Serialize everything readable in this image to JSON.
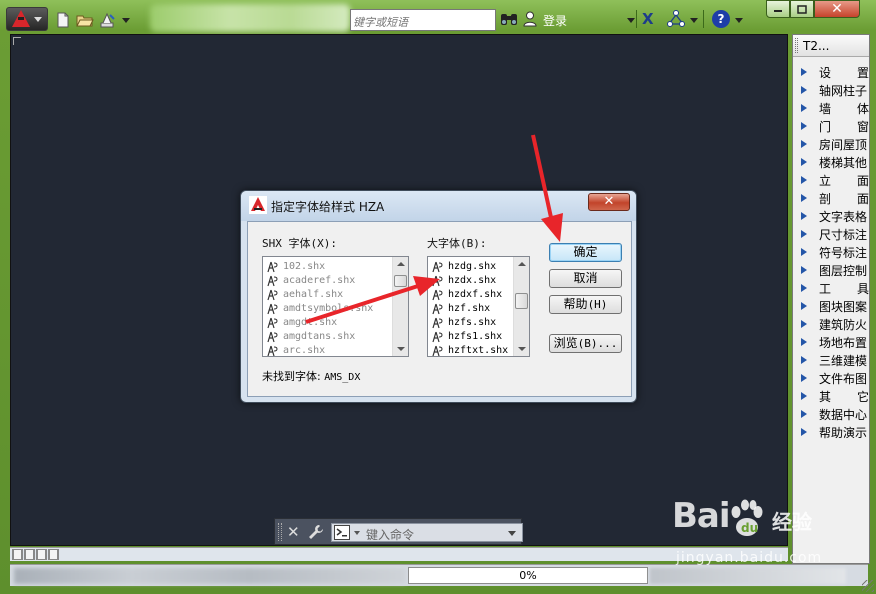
{
  "titlebar": {
    "search_placeholder": "键字或短语",
    "login_label": "登录"
  },
  "palette": {
    "title": "T2...",
    "items": [
      {
        "label": "设置",
        "spaced": true
      },
      {
        "label": "轴网柱子",
        "spaced": false
      },
      {
        "label": "墙体",
        "spaced": true
      },
      {
        "label": "门窗",
        "spaced": true
      },
      {
        "label": "房间屋顶",
        "spaced": false
      },
      {
        "label": "楼梯其他",
        "spaced": false
      },
      {
        "label": "立面",
        "spaced": true
      },
      {
        "label": "剖面",
        "spaced": true
      },
      {
        "label": "文字表格",
        "spaced": false
      },
      {
        "label": "尺寸标注",
        "spaced": false
      },
      {
        "label": "符号标注",
        "spaced": false
      },
      {
        "label": "图层控制",
        "spaced": false
      },
      {
        "label": "工具",
        "spaced": true
      },
      {
        "label": "图块图案",
        "spaced": false
      },
      {
        "label": "建筑防火",
        "spaced": false
      },
      {
        "label": "场地布置",
        "spaced": false
      },
      {
        "label": "三维建模",
        "spaced": false
      },
      {
        "label": "文件布图",
        "spaced": false
      },
      {
        "label": "其它",
        "spaced": true
      },
      {
        "label": "数据中心",
        "spaced": false
      },
      {
        "label": "帮助演示",
        "spaced": false
      }
    ]
  },
  "dialog": {
    "title": "指定字体给样式 HZA",
    "shx_label": "SHX 字体(X):",
    "big_label": "大字体(B):",
    "shx_fonts": [
      "102.shx",
      "acaderef.shx",
      "aehalf.shx",
      "amdtsymbols.shx",
      "amgdt.shx",
      "amgdtans.shx",
      "arc.shx"
    ],
    "big_fonts": [
      "hzdg.shx",
      "hzdx.shx",
      "hzdxf.shx",
      "hzf.shx",
      "hzfs.shx",
      "hzfs1.shx",
      "hzftxt.shx"
    ],
    "ok_label": "确定",
    "cancel_label": "取消",
    "help_label": "帮助",
    "help_key": "(H)",
    "browse_label": "浏览",
    "browse_key": "(B)...",
    "not_found_label": "未找到字体:",
    "not_found_value": "AMS_DX"
  },
  "command": {
    "placeholder": "键入命令"
  },
  "status": {
    "progress_text": "0%"
  },
  "watermark": {
    "brand": "Bai",
    "brand_suffix": "du",
    "product": "经验",
    "url": "jingyan.baidu.com"
  },
  "colors": {
    "canvas": "#222834",
    "frame": "#6aa032",
    "arrow": "#e8252a",
    "palette_arrow": "#2456a8"
  }
}
